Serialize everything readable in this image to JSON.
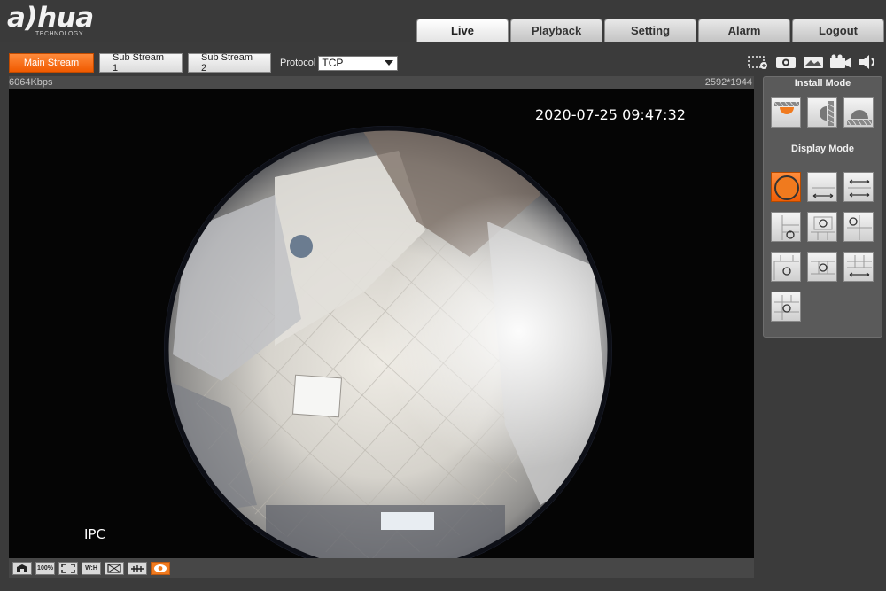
{
  "brand": {
    "name": "a)hua",
    "tagline": "TECHNOLOGY"
  },
  "nav": {
    "tabs": [
      {
        "label": "Live",
        "active": true
      },
      {
        "label": "Playback",
        "active": false
      },
      {
        "label": "Setting",
        "active": false
      },
      {
        "label": "Alarm",
        "active": false
      },
      {
        "label": "Logout",
        "active": false
      }
    ]
  },
  "streams": {
    "main": "Main Stream",
    "sub1": "Sub Stream 1",
    "sub2": "Sub Stream 2",
    "active": "main"
  },
  "protocol": {
    "label": "Protocol",
    "value": "TCP"
  },
  "right_tools": [
    "zoom-region-icon",
    "snapshot-icon",
    "triple-snapshot-icon",
    "record-icon",
    "audio-icon"
  ],
  "video": {
    "bitrate": "6064Kbps",
    "resolution": "2592*1944",
    "osd_time": "2020-07-25 09:47:32",
    "osd_channel": "IPC"
  },
  "bottom_tools": [
    {
      "icon": "image-adjust-icon",
      "on": false
    },
    {
      "icon": "original-size-icon",
      "text": "100%",
      "on": false
    },
    {
      "icon": "fullscreen-icon",
      "on": false
    },
    {
      "icon": "aspect-ratio-icon",
      "text": "W:H",
      "on": false
    },
    {
      "icon": "fluency-icon",
      "on": false
    },
    {
      "icon": "rule-icon",
      "on": false
    },
    {
      "icon": "fisheye-eye-icon",
      "on": true
    }
  ],
  "panel": {
    "install_mode_title": "Install Mode",
    "display_mode_title": "Display Mode",
    "install_modes": [
      "ceiling-mount-icon",
      "wall-mount-icon",
      "ground-mount-icon"
    ],
    "active_install_mode": 0,
    "display_modes": [
      "1O-icon",
      "1P-icon",
      "2P-icon",
      "1O+3R-icon",
      "1O+4R-icon",
      "1O+1P+3R-icon",
      "1O+8R-icon",
      "1O+1P+6R-icon",
      "1O+2P+...",
      "1P+6R-icon"
    ],
    "active_display_mode": 0
  },
  "colors": {
    "accent": "#f05a00",
    "bg": "#3b3b3b",
    "panel": "#5a5a5a"
  }
}
